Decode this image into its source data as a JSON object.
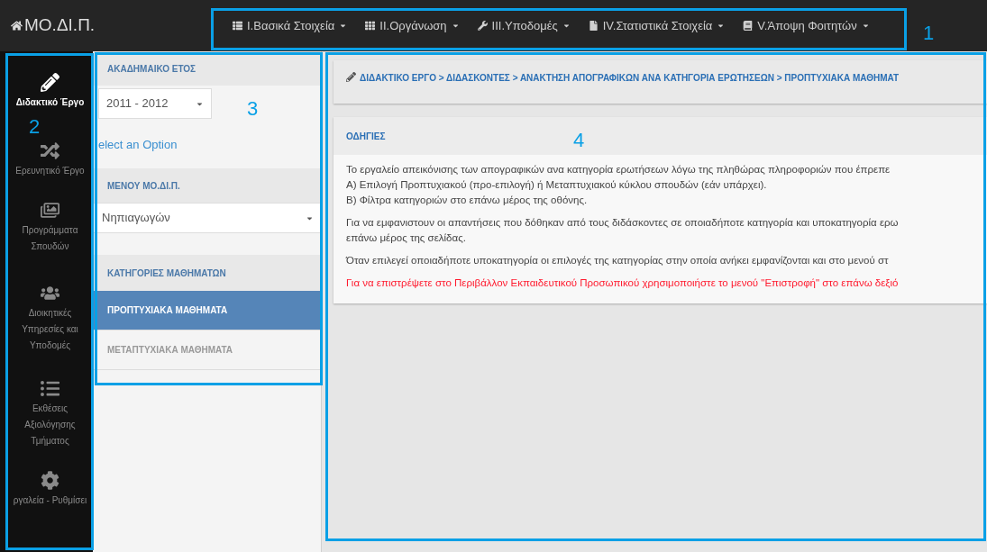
{
  "brand": "ΜΟ.ΔΙ.Π.",
  "top_menu": [
    {
      "label": "I.Βασικά Στοιχεία",
      "kind": "list"
    },
    {
      "label": "II.Οργάνωση",
      "kind": "grid"
    },
    {
      "label": "III.Υποδομές",
      "kind": "wrench"
    },
    {
      "label": "IV.Στατιστικά Στοιχεία",
      "kind": "file"
    },
    {
      "label": "V.Άποψη Φοιτητών",
      "kind": "book"
    }
  ],
  "sidebar": {
    "items": [
      {
        "lines": [
          "Διδακτικό Έργο"
        ],
        "kind": "pencil",
        "selected": true
      },
      {
        "lines": [
          "Ερευνητικό Έργο"
        ],
        "kind": "shuffle",
        "selected": false
      },
      {
        "lines": [
          "Προγράμματα",
          "Σπουδών"
        ],
        "kind": "pictures",
        "selected": false
      },
      {
        "lines": [
          "Διοικητικές",
          "Υπηρεσίες και",
          "Υποδομές"
        ],
        "kind": "users",
        "selected": false
      },
      {
        "lines": [
          "Εκθέσεις",
          "Αξιολόγησης",
          "Τμήματος"
        ],
        "kind": "list",
        "selected": false
      },
      {
        "lines": [
          "ργαλεία - Ρυθμίσει"
        ],
        "kind": "gear",
        "selected": false
      }
    ]
  },
  "filters": {
    "year_heading": "ΑΚΑΔΗΜΑΙΚΟ ΕΤΟΣ",
    "year_value": "2011 - 2012",
    "select_hint": "elect an Option",
    "menu_heading": "ΜΕΝΟΥ ΜΟ.ΔΙ.Π.",
    "menu_value": "Νηπιαγωγών",
    "categories_heading": "ΚΑΤΗΓΟΡΙΕΣ ΜΑΘΗΜΑΤΩΝ",
    "categories": [
      {
        "label": "ΠΡΟΠΤΥΧΙΑΚΑ ΜΑΘΗΜΑΤΑ",
        "selected": true
      },
      {
        "label": "ΜΕΤΑΠΤΥΧΙΑΚΑ ΜΑΘΗΜΑΤΑ",
        "selected": false
      }
    ]
  },
  "breadcrumb": "ΔΙΔΑΚΤΙΚΟ ΕΡΓΟ > ΔΙΔΑΣΚΟΝΤΕΣ > ΑΝΑΚΤΗΣΗ ΑΠΟΓΡΑΦΙΚΩΝ ΑΝΑ ΚΑΤΗΓΟΡΙΑ ΕΡΩΤΗΣΕΩΝ > ΠΡΟΠΤΥΧΙΑΚΑ ΜΑΘΗΜΑΤ",
  "instructions": {
    "title": "ΟΔΗΓΙΕΣ",
    "paragraphs": [
      {
        "lines": [
          "Το εργαλείο απεικόνισης των απογραφικών ανα κατηγορία ερωτήσεων λόγω της πληθώρας πληροφοριών που έπρεπε",
          "Α) Επιλογή Προπτυχιακού (προ-επιλογή) ή Μεταπτυχιακού κύκλου σπουδών (εάν υπάρχει).",
          "Β) Φίλτρα κατηγοριών στο επάνω μέρος της οθόνης."
        ],
        "kind": "normal"
      },
      {
        "lines": [
          "Για να εμφανιστουν οι απαντήσεις που δόθηκαν από τους διδάσκοντες σε οποιαδήποτε κατηγορία και υποκατηγορία ερω",
          "επάνω μέρος της σελίδας."
        ],
        "kind": "normal"
      },
      {
        "lines": [
          "Όταν επιλεγεί οποιαδήποτε υποκατηγορία οι επιλογές της κατηγορίας στην οποία ανήκει εμφανίζονται και στο μενού στ"
        ],
        "kind": "normal"
      },
      {
        "lines": [
          "Για να επιστρέψετε στο Περιβάλλον Εκπαιδευτικού Προσωπικού χρησιμοποιήστε το μενού \"Επιστροφή\" στο επάνω δεξιό"
        ],
        "kind": "warning"
      }
    ]
  },
  "callouts": [
    "1",
    "2",
    "3",
    "4"
  ]
}
